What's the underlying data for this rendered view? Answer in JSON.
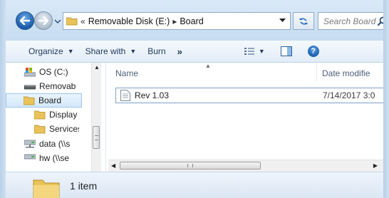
{
  "address_bar": {
    "overflow_chevron": "«",
    "crumbs": [
      "Removable Disk (E:)",
      "Board"
    ],
    "separator": "▸"
  },
  "search": {
    "placeholder": "Search Board"
  },
  "toolbar": {
    "organize": "Organize",
    "share_with": "Share with",
    "burn": "Burn",
    "more": "»"
  },
  "nav_pane": {
    "items": [
      {
        "label": "OS (C:)",
        "icon": "drive-icon"
      },
      {
        "label": "Removable Disk (E:)",
        "icon": "removable-drive-icon"
      },
      {
        "label": "Board",
        "icon": "folder-icon",
        "selected": true
      },
      {
        "label": "Display",
        "icon": "folder-icon"
      },
      {
        "label": "Services",
        "icon": "folder-icon"
      },
      {
        "label": "data (\\\\s",
        "icon": "network-drive-icon"
      },
      {
        "label": "hw (\\\\se",
        "icon": "network-drive-icon"
      }
    ]
  },
  "columns": {
    "name": "Name",
    "date_modified": "Date modifie"
  },
  "files": [
    {
      "name": "Rev 1.03",
      "date": "7/14/2017 3:0",
      "icon": "document-icon"
    }
  ],
  "status": {
    "item_count": "1 item"
  },
  "colors": {
    "frame": "#c6dcf1",
    "accent": "#1b5aa8",
    "selection": "#d3e8fb"
  }
}
